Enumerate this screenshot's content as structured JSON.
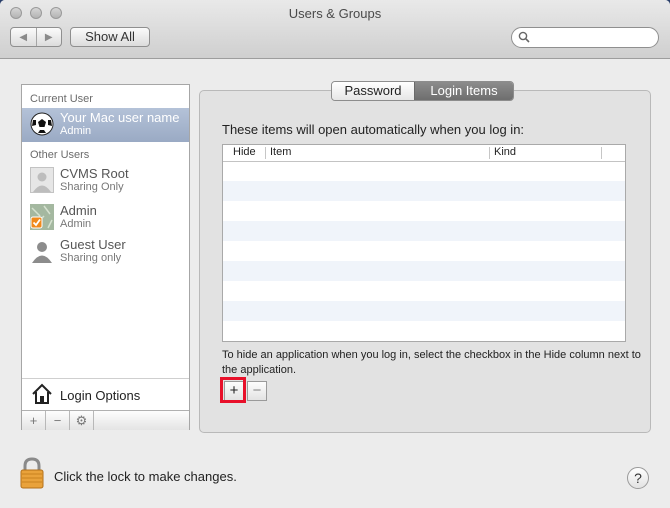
{
  "window": {
    "title": "Users & Groups"
  },
  "toolbar": {
    "back_icon": "left-arrow-icon",
    "forward_icon": "right-arrow-icon",
    "show_all_label": "Show All",
    "search_placeholder": ""
  },
  "sidebar": {
    "current_user_heading": "Current User",
    "other_users_heading": "Other Users",
    "current_user": {
      "name": "Your Mac user name",
      "role": "Admin"
    },
    "other_users": [
      {
        "name": "CVMS Root",
        "role": "Sharing Only"
      },
      {
        "name": "Admin",
        "role": "Admin"
      },
      {
        "name": "Guest User",
        "role": "Sharing only"
      }
    ],
    "login_options_label": "Login Options",
    "bar": {
      "add": "+",
      "remove": "−",
      "action": "⚙"
    }
  },
  "tabs": {
    "password": "Password",
    "login_items": "Login Items"
  },
  "login_items": {
    "intro": "These items will open automatically when you log in:",
    "columns": [
      "Hide",
      "Item",
      "Kind"
    ],
    "rows": [],
    "hint": "To hide an application when you log in, select the checkbox in the Hide column next to the application.",
    "add_label": "+",
    "remove_label": "−"
  },
  "footer": {
    "lock_text": "Click the lock to make changes.",
    "help_label": "?"
  },
  "colors": {
    "selection": "#a5b4cc",
    "highlight": "#e8102a",
    "tab_selected": "#7a7a7a"
  }
}
